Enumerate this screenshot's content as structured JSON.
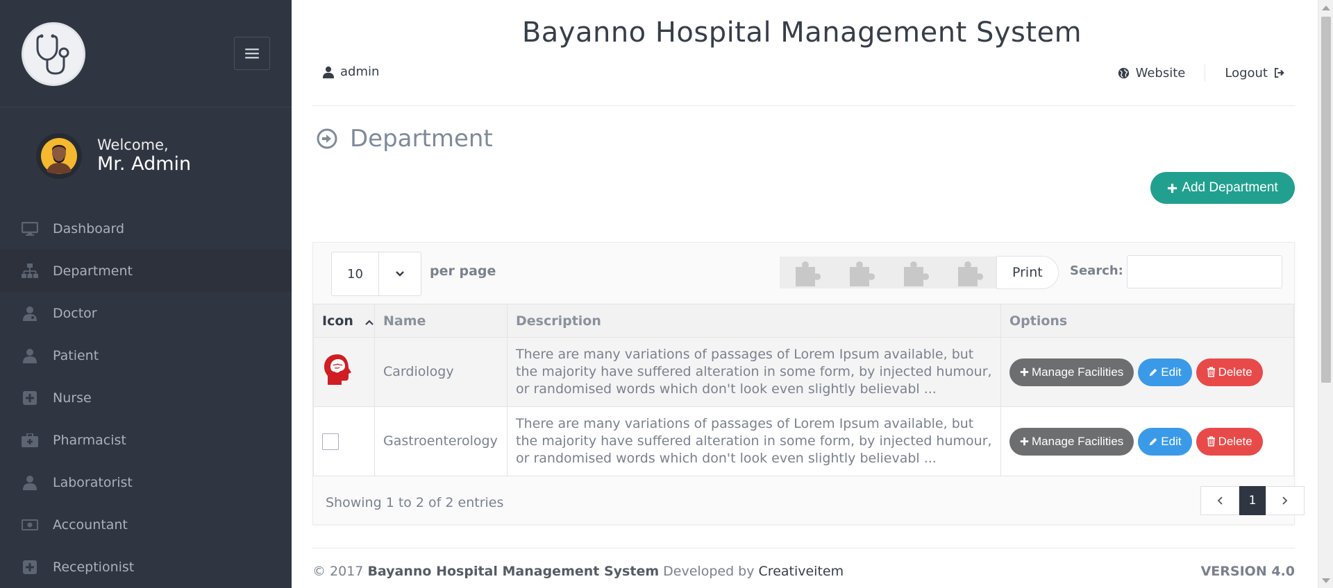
{
  "sidebar": {
    "welcome": "Welcome,",
    "user_name": "Mr. Admin",
    "items": [
      {
        "label": "Dashboard",
        "icon": "monitor-icon"
      },
      {
        "label": "Department",
        "icon": "sitemap-icon"
      },
      {
        "label": "Doctor",
        "icon": "user-md-icon"
      },
      {
        "label": "Patient",
        "icon": "user-icon"
      },
      {
        "label": "Nurse",
        "icon": "plus-square-icon"
      },
      {
        "label": "Pharmacist",
        "icon": "medkit-icon"
      },
      {
        "label": "Laboratorist",
        "icon": "user-icon"
      },
      {
        "label": "Accountant",
        "icon": "money-icon"
      },
      {
        "label": "Receptionist",
        "icon": "plus-square-icon"
      }
    ]
  },
  "header": {
    "title": "Bayanno Hospital Management System",
    "user": "admin",
    "website": "Website",
    "logout": "Logout"
  },
  "page": {
    "title": "Department",
    "add_button": "Add Department"
  },
  "table_controls": {
    "per_page_value": "10",
    "per_page_label": "per page",
    "print_label": "Print",
    "search_label": "Search:"
  },
  "table": {
    "columns": [
      "Icon",
      "Name",
      "Description",
      "Options"
    ],
    "rows": [
      {
        "name": "Cardiology",
        "description": "There are many variations of passages of Lorem Ipsum available, but the majority have suffered alteration in some form, by injected humour, or randomised words which don't look even slightly believabl ..."
      },
      {
        "name": "Gastroenterology",
        "description": "There are many variations of passages of Lorem Ipsum available, but the majority have suffered alteration in some form, by injected humour, or randomised words which don't look even slightly believabl ..."
      }
    ],
    "buttons": {
      "manage": "Manage Facilities",
      "edit": "Edit",
      "delete": "Delete"
    }
  },
  "pagination": {
    "showing": "Showing 1 to 2 of 2 entries",
    "current_page": "1"
  },
  "footer": {
    "copyright": "© 2017",
    "system_name": "Bayanno Hospital Management System",
    "developed_by": "Developed by",
    "developer": "Creativeitem",
    "version": "VERSION 4.0"
  },
  "colors": {
    "sidebar_bg": "#303641",
    "accent_teal": "#21a08f",
    "edit_blue": "#3a9ae8",
    "delete_red": "#e84a4a",
    "manage_gray": "#6d6e70"
  }
}
